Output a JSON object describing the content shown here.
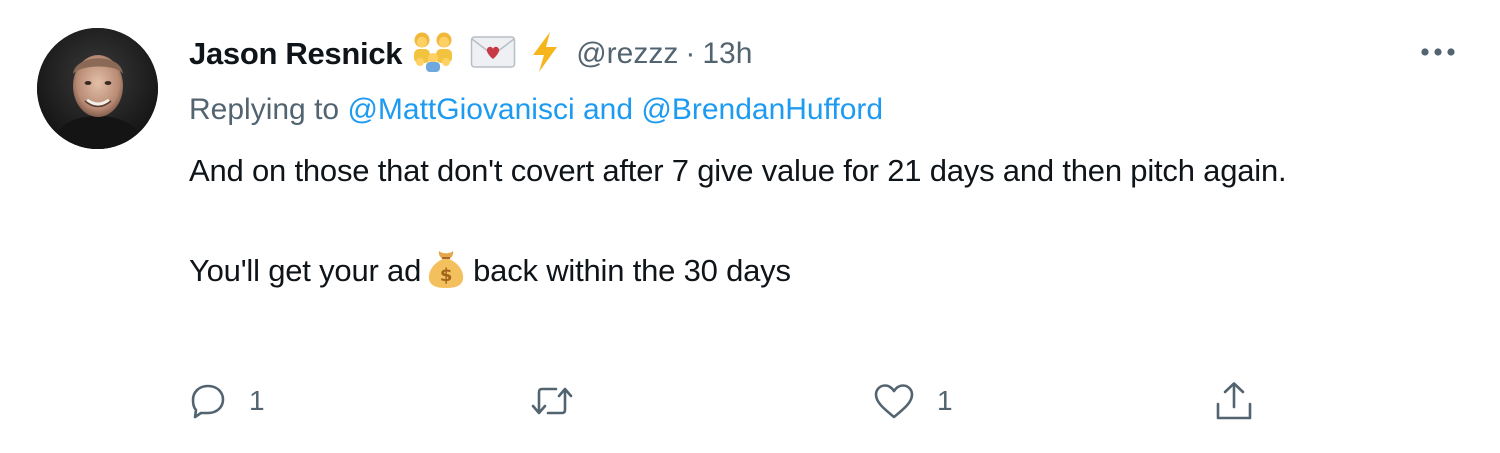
{
  "tweet": {
    "author": {
      "name": "Jason Resnick",
      "badges": [
        "family-icon",
        "love-letter-icon",
        "lightning-icon"
      ],
      "handle": "@rezzz",
      "separator": "·",
      "time": "13h"
    },
    "replying": {
      "prefix": "Replying to",
      "mention_1": "@MattGiovanisci",
      "conjunction": "and",
      "mention_2": "@BrendanHufford"
    },
    "text": {
      "line_1": "And on those that don't covert after 7 give value for 21 days and then pitch again.",
      "line_2_before": "You'll get your ad",
      "line_2_after": "back within the 30 days"
    },
    "actions": {
      "reply_count": "1",
      "retweet_count": "",
      "like_count": "1"
    }
  },
  "colors": {
    "text_primary": "#0f1419",
    "text_secondary": "#536471",
    "mention": "#1d9bf0"
  }
}
